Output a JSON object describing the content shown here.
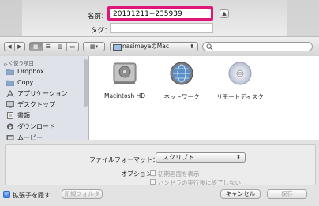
{
  "name_row": {
    "label": "名前：",
    "value": "20131211−235939"
  },
  "tag_row": {
    "label": "タグ：",
    "value": ""
  },
  "toolbar": {
    "location": "nasimeyaのMac"
  },
  "sidebar": {
    "header": "よく使う項目",
    "items": [
      {
        "label": "Dropbox",
        "icon": "folder-icon"
      },
      {
        "label": "Copy",
        "icon": "folder-icon"
      },
      {
        "label": "アプリケーション",
        "icon": "applications-icon"
      },
      {
        "label": "デスクトップ",
        "icon": "desktop-icon"
      },
      {
        "label": "書類",
        "icon": "documents-icon"
      },
      {
        "label": "ダウンロード",
        "icon": "downloads-icon"
      },
      {
        "label": "ムービー",
        "icon": "movies-icon"
      }
    ]
  },
  "files": [
    {
      "label": "Macintosh HD",
      "icon": "hard-drive-icon"
    },
    {
      "label": "ネットワーク",
      "icon": "network-globe-icon"
    },
    {
      "label": "リモートディスク",
      "icon": "disc-icon"
    }
  ],
  "format": {
    "label": "ファイルフォーマット：",
    "value": "スクリプト"
  },
  "options": {
    "label": "オプション：",
    "items": [
      {
        "label": "初期画面を表示",
        "checked": false,
        "enabled": false
      },
      {
        "label": "ハンドラの実行後に終了しない",
        "checked": false,
        "enabled": false
      }
    ]
  },
  "footer": {
    "hide_extension": "拡張子を隠す",
    "new_folder": "新規フォルダ",
    "cancel": "キャンセル",
    "save": "保存"
  },
  "colors": {
    "highlight_border": "#e0157a"
  }
}
